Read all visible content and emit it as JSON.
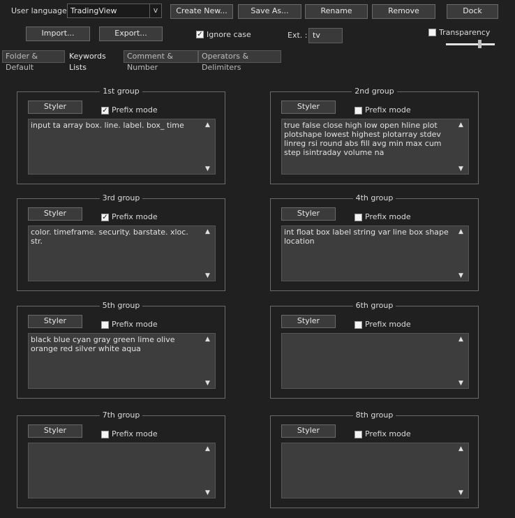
{
  "toolbar": {
    "user_language_label": "User language :",
    "language_value": "TradingView",
    "language_arrow": "v",
    "create_new": "Create New...",
    "save_as": "Save As...",
    "rename": "Rename",
    "remove": "Remove",
    "dock": "Dock",
    "import": "Import...",
    "export": "Export...",
    "ignore_case_label": "Ignore case",
    "ignore_case_checked": true,
    "ext_label": "Ext. :",
    "ext_value": "tv",
    "transparency_label": "Transparency",
    "transparency_checked": false
  },
  "tabs": [
    {
      "label": "Folder & Default",
      "active": false
    },
    {
      "label": "Keywords Lists",
      "active": true
    },
    {
      "label": "Comment & Number",
      "active": false
    },
    {
      "label": "Operators & Delimiters",
      "active": false
    }
  ],
  "groups": [
    {
      "title": "1st group",
      "styler": "Styler",
      "prefix_label": "Prefix mode",
      "prefix_checked": true,
      "text": "input ta array box. line. label. box_ time"
    },
    {
      "title": "2nd group",
      "styler": "Styler",
      "prefix_label": "Prefix mode",
      "prefix_checked": false,
      "text": "true false close high low open hline plot plotshape lowest highest plotarray stdev linreg rsi round abs fill avg min max cum step isintraday volume na"
    },
    {
      "title": "3rd group",
      "styler": "Styler",
      "prefix_label": "Prefix mode",
      "prefix_checked": true,
      "text": "color. timeframe. security. barstate. xloc. str."
    },
    {
      "title": "4th group",
      "styler": "Styler",
      "prefix_label": "Prefix mode",
      "prefix_checked": false,
      "text": "int float box label string var line box shape location"
    },
    {
      "title": "5th group",
      "styler": "Styler",
      "prefix_label": "Prefix mode",
      "prefix_checked": false,
      "text": "black blue cyan gray green lime olive orange red silver white aqua"
    },
    {
      "title": "6th group",
      "styler": "Styler",
      "prefix_label": "Prefix mode",
      "prefix_checked": false,
      "text": ""
    },
    {
      "title": "7th group",
      "styler": "Styler",
      "prefix_label": "Prefix mode",
      "prefix_checked": false,
      "text": ""
    },
    {
      "title": "8th group",
      "styler": "Styler",
      "prefix_label": "Prefix mode",
      "prefix_checked": false,
      "text": ""
    }
  ],
  "icons": {
    "check": "✓",
    "scroll_up": "▲",
    "scroll_down": "▼"
  }
}
